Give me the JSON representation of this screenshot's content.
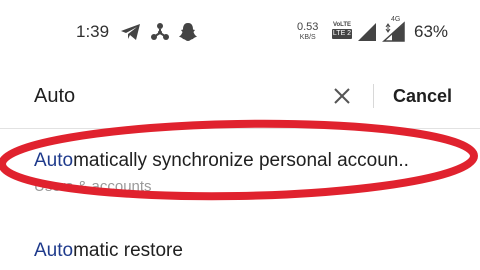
{
  "status_bar": {
    "time": "1:39",
    "net_speed_value": "0.53",
    "net_speed_unit": "KB/S",
    "volte_top": "VoLTE",
    "volte_bottom": "LTE 2",
    "signal_network_label": "4G",
    "battery_percent": "63%"
  },
  "search": {
    "query": "Auto",
    "cancel_label": "Cancel"
  },
  "results": [
    {
      "match": "Auto",
      "rest": "matically synchronize personal accoun..",
      "subtitle": "Users & accounts"
    },
    {
      "match": "Auto",
      "rest": "matic restore"
    }
  ],
  "annotation": {
    "color": "#e0222e"
  }
}
